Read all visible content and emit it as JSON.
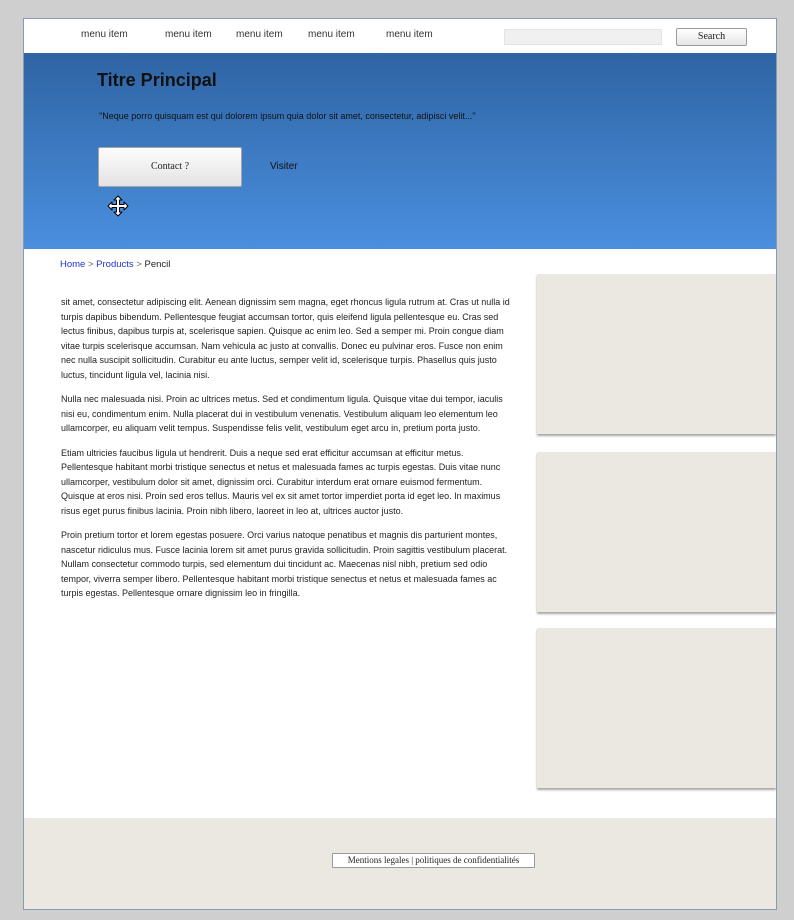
{
  "nav": {
    "items": [
      {
        "label": "menu item"
      },
      {
        "label": "menu item"
      },
      {
        "label": "menu item"
      },
      {
        "label": "menu item"
      },
      {
        "label": "menu item"
      }
    ],
    "search_placeholder": "",
    "search_button": "Search"
  },
  "hero": {
    "title": "Titre Principal",
    "quote": "\"Neque porro quisquam est qui dolorem ipsum quia dolor sit amet, consectetur, adipisci velit...\"",
    "contact_button": "Contact ?",
    "visit_link": "Visiter"
  },
  "breadcrumb": {
    "home": "Home",
    "separator": " > ",
    "products": "Products",
    "current": "Pencil"
  },
  "content": {
    "paragraphs": [
      "sit amet, consectetur adipiscing elit. Aenean dignissim sem magna, eget rhoncus ligula rutrum at. Cras ut nulla id turpis dapibus bibendum. Pellentesque feugiat accumsan tortor, quis eleifend ligula pellentesque eu. Cras sed lectus finibus, dapibus turpis at, scelerisque sapien. Quisque ac enim leo. Sed a semper mi. Proin congue diam vitae turpis scelerisque accumsan. Nam vehicula ac justo at convallis. Donec eu pulvinar eros. Fusce non enim nec nulla suscipit sollicitudin. Curabitur eu ante luctus, semper velit id, scelerisque turpis. Phasellus quis justo luctus, tincidunt ligula vel, lacinia nisi.",
      "Nulla nec malesuada nisi. Proin ac ultrices metus. Sed et condimentum ligula. Quisque vitae dui tempor, iaculis nisi eu, condimentum enim. Nulla placerat dui in vestibulum venenatis. Vestibulum aliquam leo elementum leo ullamcorper, eu aliquam velit tempus. Suspendisse felis velit, vestibulum eget arcu in, pretium porta justo.",
      "Etiam ultricies faucibus ligula ut hendrerit. Duis a neque sed erat efficitur accumsan at efficitur metus. Pellentesque habitant morbi tristique senectus et netus et malesuada fames ac turpis egestas. Duis vitae nunc ullamcorper, vestibulum dolor sit amet, dignissim orci. Curabitur interdum erat ornare euismod fermentum. Quisque at eros nisi. Proin sed eros tellus. Mauris vel ex sit amet tortor imperdiet porta id eget leo. In maximus risus eget purus finibus lacinia. Proin nibh libero, laoreet in leo at, ultrices auctor justo.",
      "Proin pretium tortor et lorem egestas posuere. Orci varius natoque penatibus et magnis dis parturient montes, nascetur ridiculus mus. Fusce lacinia lorem sit amet purus gravida sollicitudin. Proin sagittis vestibulum placerat. Nullam consectetur commodo turpis, sed elementum dui tincidunt ac. Maecenas nisl nibh, pretium sed odio tempor, viverra semper libero. Pellentesque habitant morbi tristique senectus et netus et malesuada fames ac turpis egestas. Pellentesque ornare dignissim leo in fringilla."
    ]
  },
  "footer": {
    "link": "Mentions legales | politiques de confidentialités"
  },
  "colors": {
    "hero_top": "#2f64a3",
    "hero_bottom": "#4a8fdf",
    "sidebar_box": "#ebe8e1",
    "link": "#2233cc"
  },
  "icons": {
    "cursor": "move-cursor-icon"
  }
}
